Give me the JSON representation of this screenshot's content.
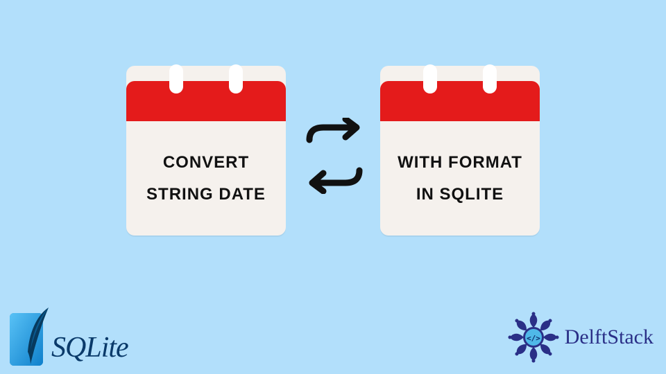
{
  "calendar_left": {
    "line1": "Convert",
    "line2": "String Date"
  },
  "calendar_right": {
    "line1": "With Format",
    "line2": "In SQLite"
  },
  "sqlite": {
    "name": "SQLite"
  },
  "delftstack": {
    "name": "DelftStack",
    "code_symbol": "</>"
  },
  "colors": {
    "bg": "#b2dffb",
    "calendar_header": "#e41b1b",
    "calendar_body": "#f5f1ed",
    "sqlite_blue": "#0f80cc",
    "delft_blue": "#2a2f87"
  }
}
